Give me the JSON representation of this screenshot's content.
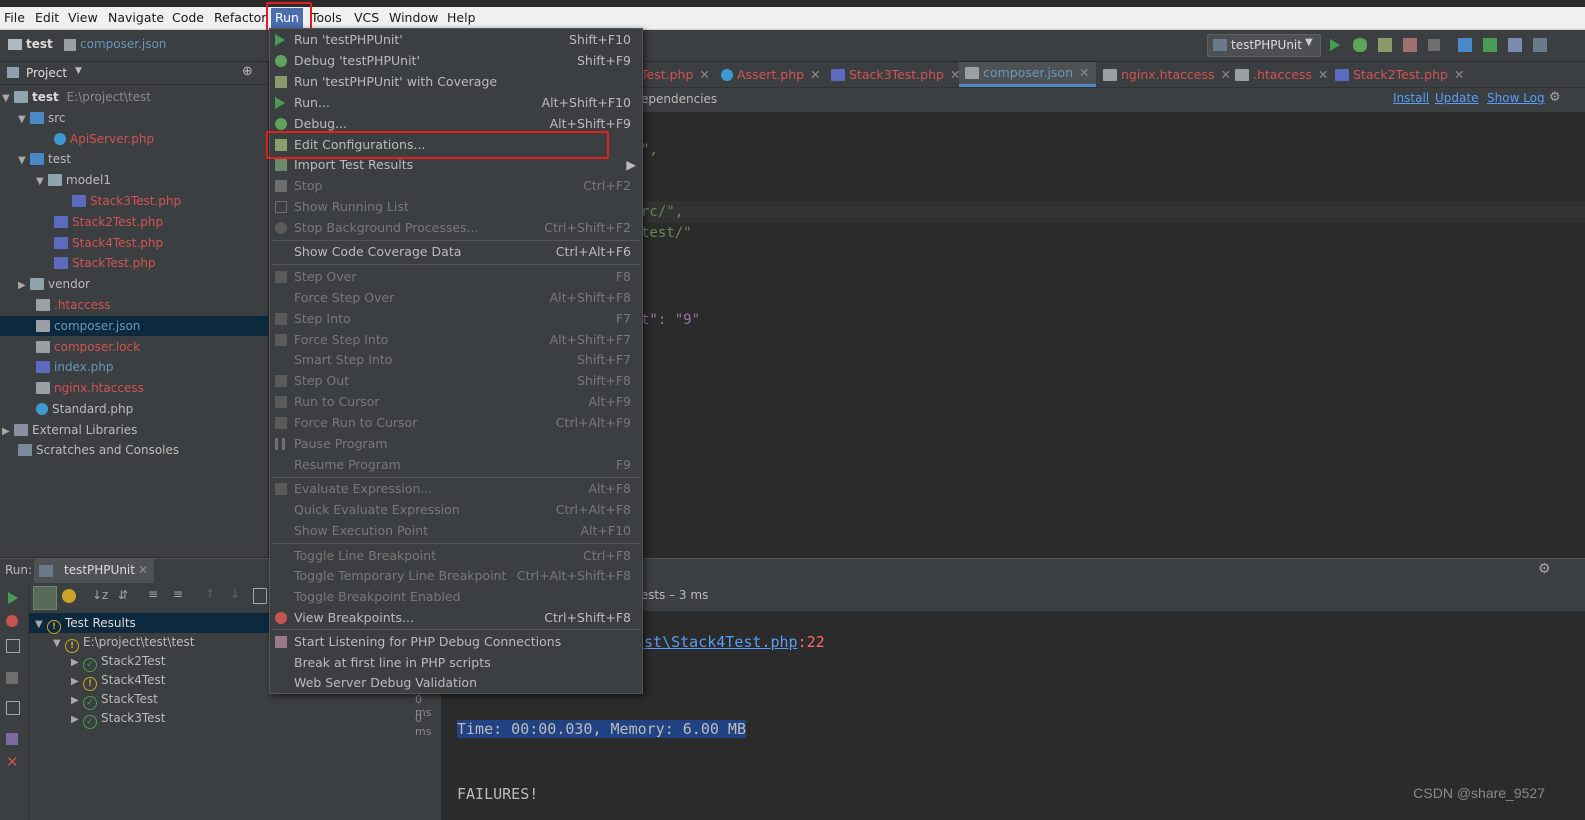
{
  "menubar": {
    "items": [
      "File",
      "Edit",
      "View",
      "Navigate",
      "Code",
      "Refactor",
      "Run",
      "Tools",
      "VCS",
      "Window",
      "Help"
    ],
    "active": "Run"
  },
  "navbar": {
    "breadcrumb": [
      "test",
      "composer.json"
    ],
    "run_config": "testPHPUnit"
  },
  "project_panel": {
    "title": "Project",
    "root": {
      "name": "test",
      "path": "E:\\project\\test"
    },
    "tree": [
      {
        "label": "src"
      },
      {
        "label": "ApiServer.php"
      },
      {
        "label": "test"
      },
      {
        "label": "model1"
      },
      {
        "label": "Stack3Test.php"
      },
      {
        "label": "Stack2Test.php"
      },
      {
        "label": "Stack4Test.php"
      },
      {
        "label": "StackTest.php"
      },
      {
        "label": "vendor"
      },
      {
        "label": ".htaccess"
      },
      {
        "label": "composer.json"
      },
      {
        "label": "composer.lock"
      },
      {
        "label": "index.php"
      },
      {
        "label": "nginx.htaccess"
      },
      {
        "label": "Standard.php"
      },
      {
        "label": "External Libraries"
      },
      {
        "label": "Scratches and Consoles"
      }
    ]
  },
  "editor": {
    "tabs": [
      {
        "label": "Test.php"
      },
      {
        "label": "Assert.php"
      },
      {
        "label": "Stack3Test.php"
      },
      {
        "label": "composer.json"
      },
      {
        "label": "nginx.htaccess"
      },
      {
        "label": ".htaccess"
      },
      {
        "label": "Stack2Test.php"
      }
    ],
    "active_tab": "composer.json",
    "banner_text": "ependencies",
    "banner_links": [
      "Install",
      "Update",
      "Show Log"
    ],
    "code_lines": [
      "\",",
      "rc/\",",
      "test/\"",
      "t\": \"9\""
    ]
  },
  "run_menu": {
    "items": [
      {
        "label": "Run 'testPHPUnit'",
        "shortcut": "Shift+F10"
      },
      {
        "label": "Debug 'testPHPUnit'",
        "shortcut": "Shift+F9"
      },
      {
        "label": "Run 'testPHPUnit' with Coverage",
        "shortcut": ""
      },
      {
        "label": "Run...",
        "shortcut": "Alt+Shift+F10"
      },
      {
        "label": "Debug...",
        "shortcut": "Alt+Shift+F9"
      },
      {
        "label": "Edit Configurations...",
        "shortcut": ""
      },
      {
        "label": "Import Test Results",
        "shortcut": ""
      },
      {
        "label": "Stop",
        "shortcut": "Ctrl+F2"
      },
      {
        "label": "Show Running List",
        "shortcut": ""
      },
      {
        "label": "Stop Background Processes...",
        "shortcut": "Ctrl+Shift+F2"
      },
      {
        "label": "Show Code Coverage Data",
        "shortcut": "Ctrl+Alt+F6"
      },
      {
        "label": "Step Over",
        "shortcut": "F8"
      },
      {
        "label": "Force Step Over",
        "shortcut": "Alt+Shift+F8"
      },
      {
        "label": "Step Into",
        "shortcut": "F7"
      },
      {
        "label": "Force Step Into",
        "shortcut": "Alt+Shift+F7"
      },
      {
        "label": "Smart Step Into",
        "shortcut": "Shift+F7"
      },
      {
        "label": "Step Out",
        "shortcut": "Shift+F8"
      },
      {
        "label": "Run to Cursor",
        "shortcut": "Alt+F9"
      },
      {
        "label": "Force Run to Cursor",
        "shortcut": "Ctrl+Alt+F9"
      },
      {
        "label": "Pause Program",
        "shortcut": ""
      },
      {
        "label": "Resume Program",
        "shortcut": "F9"
      },
      {
        "label": "Evaluate Expression...",
        "shortcut": "Alt+F8"
      },
      {
        "label": "Quick Evaluate Expression",
        "shortcut": "Ctrl+Alt+F8"
      },
      {
        "label": "Show Execution Point",
        "shortcut": "Alt+F10"
      },
      {
        "label": "Toggle Line Breakpoint",
        "shortcut": "Ctrl+F8"
      },
      {
        "label": "Toggle Temporary Line Breakpoint",
        "shortcut": "Ctrl+Alt+Shift+F8"
      },
      {
        "label": "Toggle Breakpoint Enabled",
        "shortcut": ""
      },
      {
        "label": "View Breakpoints...",
        "shortcut": "Ctrl+Shift+F8"
      },
      {
        "label": "Start Listening for PHP Debug Connections",
        "shortcut": ""
      },
      {
        "label": "Break at first line in PHP scripts",
        "shortcut": ""
      },
      {
        "label": "Web Server Debug Validation",
        "shortcut": ""
      }
    ]
  },
  "run_panel": {
    "label": "Run:",
    "tab": "testPHPUnit",
    "summary": "tests – 3 ms",
    "results": {
      "root": "Test Results",
      "group": "E:\\project\\test\\test",
      "tests": [
        {
          "name": "Stack2Test",
          "time": ""
        },
        {
          "name": "Stack4Test",
          "time": ""
        },
        {
          "name": "StackTest",
          "time": "0 ms"
        },
        {
          "name": "Stack3Test",
          "time": "0 ms"
        }
      ]
    },
    "console": {
      "link": "est\\Stack4Test.php",
      "link_suffix": ":22",
      "time_line": "Time: 00:00.030, Memory: 6.00 MB",
      "failures": "FAILURES!"
    }
  },
  "watermark": "CSDN @share_9527"
}
